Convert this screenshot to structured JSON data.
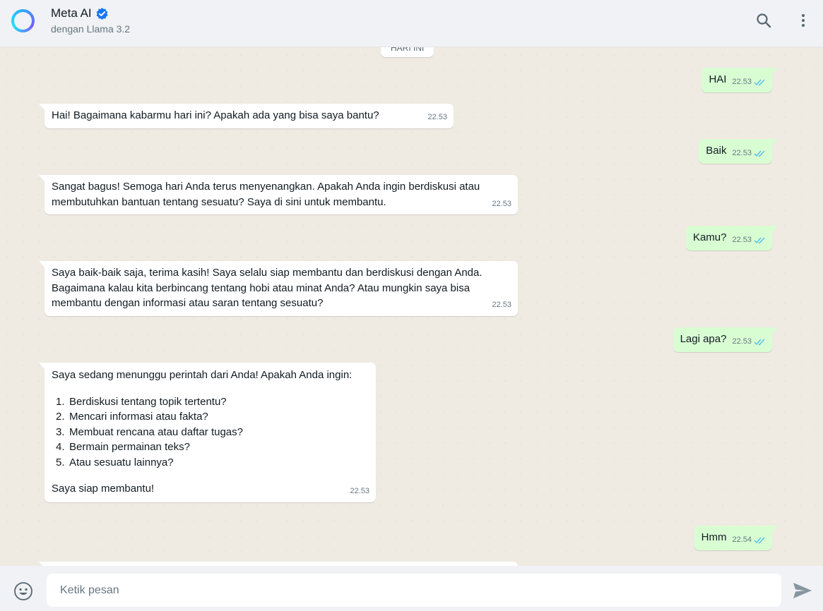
{
  "header": {
    "title": "Meta AI",
    "subtitle": "dengan Llama 3.2",
    "icons": [
      "meta-ai-logo-icon",
      "verified-badge-icon",
      "search-icon",
      "more-vertical-icon"
    ]
  },
  "date_chip": "HARI INI",
  "messages": [
    {
      "text": "HAI",
      "time": "22.53"
    },
    {
      "text": "Hai! Bagaimana kabarmu hari ini? Apakah ada yang bisa saya bantu?",
      "time": "22.53"
    },
    {
      "text": "Baik",
      "time": "22.53"
    },
    {
      "lines": [
        "Sangat bagus! Semoga hari Anda terus menyenangkan. Apakah Anda ingin berdiskusi atau",
        "membutuhkan bantuan tentang sesuatu? Saya di sini untuk membantu."
      ],
      "time": "22.53"
    },
    {
      "text": "Kamu?",
      "time": "22.53"
    },
    {
      "lines": [
        "Saya baik-baik saja, terima kasih! Saya selalu siap membantu dan berdiskusi dengan Anda.",
        "Bagaimana kalau kita berbincang tentang hobi atau minat Anda? Atau mungkin saya bisa",
        "membantu dengan informasi atau saran tentang sesuatu?"
      ],
      "time": "22.53"
    },
    {
      "text": "Lagi apa?",
      "time": "22.53"
    },
    {
      "intro": "Saya sedang menunggu perintah dari Anda! Apakah Anda ingin:",
      "items": [
        "Berdiskusi tentang topik tertentu?",
        "Mencari informasi atau fakta?",
        "Membuat rencana atau daftar tugas?",
        "Bermain permainan teks?",
        "Atau sesuatu lainnya?"
      ],
      "outro": "Saya siap membantu!",
      "time": "22.53"
    },
    {
      "text": "Hmm",
      "time": "22.54"
    }
  ],
  "compose": {
    "placeholder": "Ketik pesan",
    "icons": [
      "emoji-icon",
      "send-icon"
    ]
  },
  "colors": {
    "incoming": "#ffffff",
    "outgoing": "#d9fdd3",
    "read_ticks": "#53bdeb",
    "background": "#efeae2"
  }
}
